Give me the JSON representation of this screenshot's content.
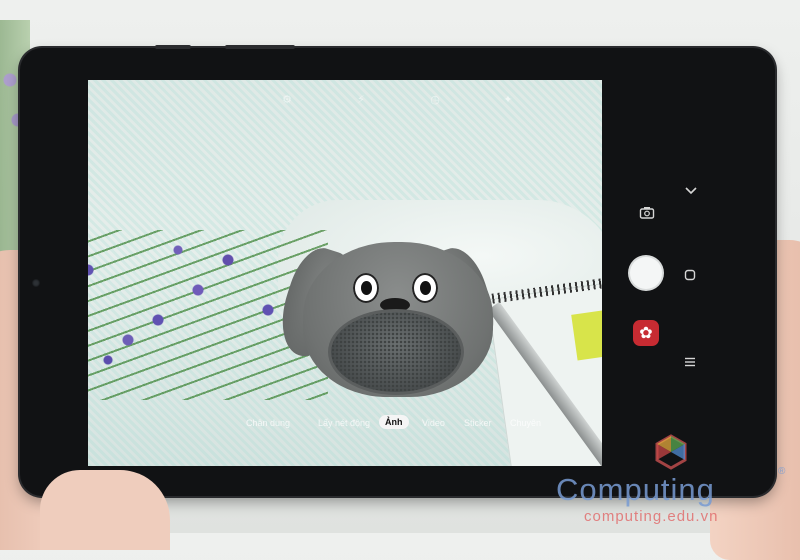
{
  "camera": {
    "modes": [
      {
        "label": "Chân dung"
      },
      {
        "label": "Lấy nét động"
      },
      {
        "label": "Ảnh",
        "active": true
      },
      {
        "label": "Video"
      },
      {
        "label": "Sticker"
      },
      {
        "label": "Chuyên"
      }
    ],
    "top_icons": [
      "settings-icon",
      "flash-icon",
      "timer-icon",
      "aspect-ratio-icon",
      "effects-icon"
    ],
    "controls": {
      "collapse_icon": "chevron-down-icon",
      "switch_camera_icon": "switch-camera-icon",
      "shutter_icon": "shutter-button",
      "record_icon": "record-icon",
      "filter_icon": "filter-flower-icon",
      "menu_icon": "menu-icon"
    }
  },
  "watermark": {
    "brand": "Computing",
    "url": "computing.edu.vn"
  },
  "colors": {
    "filter_button": "#c72b32",
    "watermark_blue": "#789bd2",
    "watermark_red": "#e16e6e"
  }
}
